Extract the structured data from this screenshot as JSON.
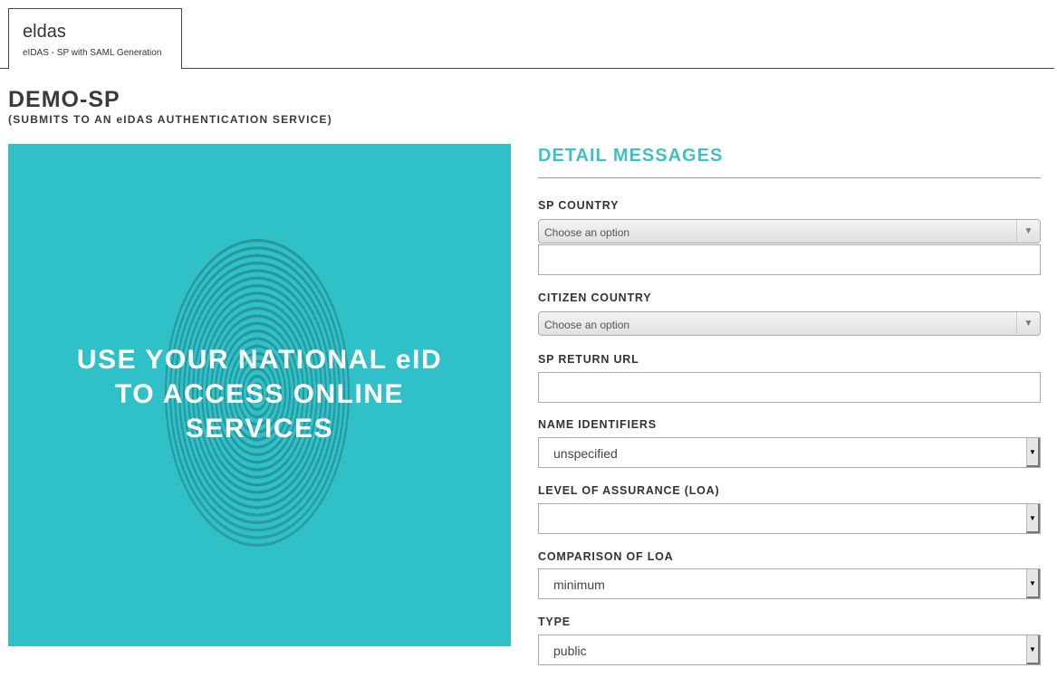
{
  "tab": {
    "title": "eldas",
    "subtitle": "eIDAS - SP with SAML Generation"
  },
  "header": {
    "title": "DEMO-SP",
    "subtitle": "(SUBMITS TO AN eIDAS AUTHENTICATION SERVICE)"
  },
  "hero": {
    "line1": "USE YOUR NATIONAL eID",
    "line2": "TO ACCESS ONLINE",
    "line3": "SERVICES"
  },
  "detail": {
    "title": "DETAIL MESSAGES"
  },
  "form": {
    "sp_country": {
      "label": "SP COUNTRY",
      "placeholder": "Choose an option",
      "value": ""
    },
    "citizen_country": {
      "label": "CITIZEN COUNTRY",
      "placeholder": "Choose an option"
    },
    "sp_return_url": {
      "label": "SP RETURN URL",
      "value": ""
    },
    "name_identifiers": {
      "label": "NAME IDENTIFIERS",
      "value": "unspecified"
    },
    "loa": {
      "label": "LEVEL OF ASSURANCE (LOA)",
      "value": ""
    },
    "comparison": {
      "label": "COMPARISON OF LOA",
      "value": "minimum"
    },
    "type": {
      "label": "TYPE",
      "value": "public"
    }
  },
  "colors": {
    "accent": "#3fbfc6",
    "hero_bg": "#2fc1c7"
  },
  "icons": {
    "dropdown": "triangle-down-icon"
  }
}
